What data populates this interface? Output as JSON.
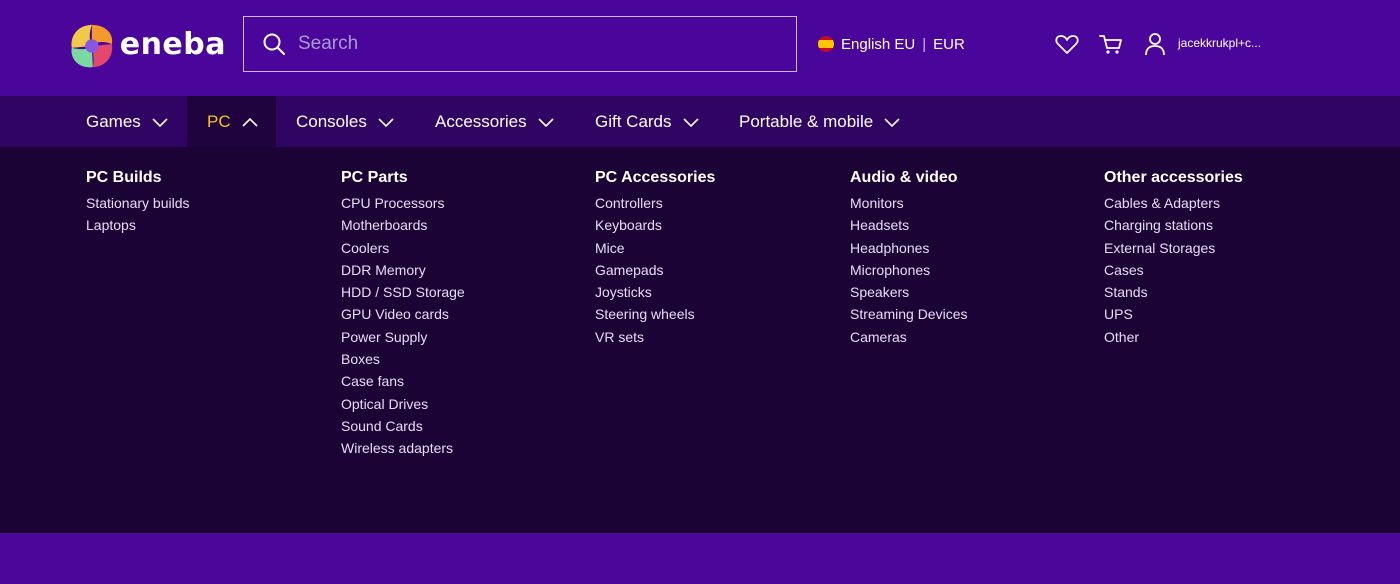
{
  "brand": {
    "name": "eneba"
  },
  "search": {
    "placeholder": "Search"
  },
  "locale": {
    "language": "English EU",
    "currency": "EUR"
  },
  "user": {
    "name": "jacekkrukpl+c..."
  },
  "icons": {
    "wishlist": "heart-icon",
    "cart": "cart-icon",
    "account": "user-icon",
    "search": "search-icon"
  },
  "nav": {
    "items": [
      {
        "label": "Games"
      },
      {
        "label": "PC"
      },
      {
        "label": "Consoles"
      },
      {
        "label": "Accessories"
      },
      {
        "label": "Gift Cards"
      },
      {
        "label": "Portable & mobile"
      }
    ]
  },
  "menu": {
    "columns": [
      {
        "title": "PC Builds",
        "items": [
          "Stationary builds",
          "Laptops"
        ]
      },
      {
        "title": "PC Parts",
        "items": [
          "CPU Processors",
          "Motherboards",
          "Coolers",
          "DDR Memory",
          "HDD / SSD Storage",
          "GPU Video cards",
          "Power Supply",
          "Boxes",
          "Case fans",
          "Optical Drives",
          "Sound Cards",
          "Wireless adapters"
        ]
      },
      {
        "title": "PC Accessories",
        "items": [
          "Controllers",
          "Keyboards",
          "Mice",
          "Gamepads",
          "Joysticks",
          "Steering wheels",
          "VR sets"
        ]
      },
      {
        "title": "Audio & video",
        "items": [
          "Monitors",
          "Headsets",
          "Headphones",
          "Microphones",
          "Speakers",
          "Streaming Devices",
          "Cameras"
        ]
      },
      {
        "title": "Other accessories",
        "items": [
          "Cables & Adapters",
          "Charging stations",
          "External Storages",
          "Cases",
          "Stands",
          "UPS",
          "Other"
        ]
      }
    ]
  },
  "colors": {
    "header_bg": "#4a069b",
    "nav_bg": "#2f0463",
    "menu_bg": "#1c0336",
    "active_accent": "#f5c518"
  }
}
